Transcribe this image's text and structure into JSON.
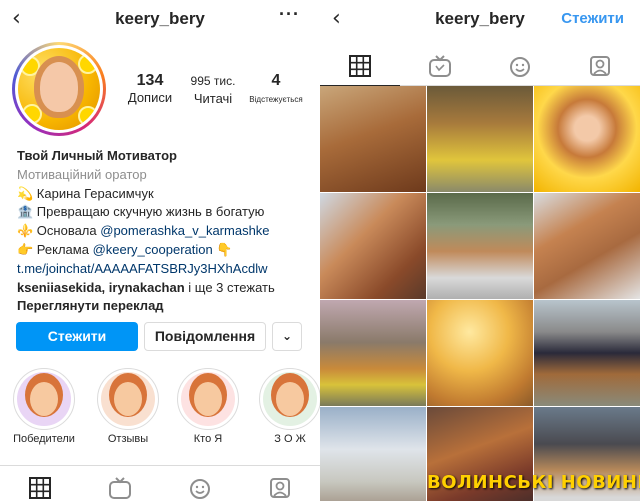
{
  "profile": {
    "username": "keery_bery",
    "stats": [
      {
        "value": "134",
        "label": "Дописи"
      },
      {
        "value": "995 тис.",
        "label": "Читачі"
      },
      {
        "value": "4",
        "label": "Відстежується"
      }
    ],
    "bio": {
      "name": "Твой Личный Мотиватор",
      "category": "Мотиваційний оратор",
      "line1": "💫 Карина Герасимчук",
      "line2": "🏦 Превращаю скучную жизнь в богатую",
      "line3_prefix": "⚜️ Основала ",
      "line3_link": "@pomerashka_v_karmashke",
      "line4_prefix": "👉 Реклама ",
      "line4_link": "@keery_cooperation",
      "line4_suffix": " 👇",
      "url": "t.me/joinchat/AAAAAFATSBRJy3HXhAcdlw",
      "followed_by_names": "kseniiasekida, irynakachan",
      "followed_by_suffix": " і ще 3 стежать",
      "translate": "Переглянути переклад"
    },
    "buttons": {
      "follow": "Стежити",
      "message": "Повідомлення",
      "more": "⌄"
    },
    "highlights": [
      {
        "label": "Победители"
      },
      {
        "label": "Отзывы"
      },
      {
        "label": "Кто Я"
      },
      {
        "label": "З О Ж"
      }
    ]
  },
  "feed_header": {
    "username": "keery_bery",
    "follow": "Стежити"
  },
  "grid_watermark": "ВОЛИНСЬКІ НОВИНИ",
  "icons": {
    "back": "chevron-left-icon",
    "more": "more-dots-icon",
    "grid": "grid-icon",
    "igtv": "igtv-icon",
    "effects": "effects-icon",
    "tagged": "tagged-icon"
  },
  "colors": {
    "accent": "#0095f6",
    "link": "#00376b",
    "follow_text": "#3897f0",
    "watermark": "#ffd000"
  }
}
